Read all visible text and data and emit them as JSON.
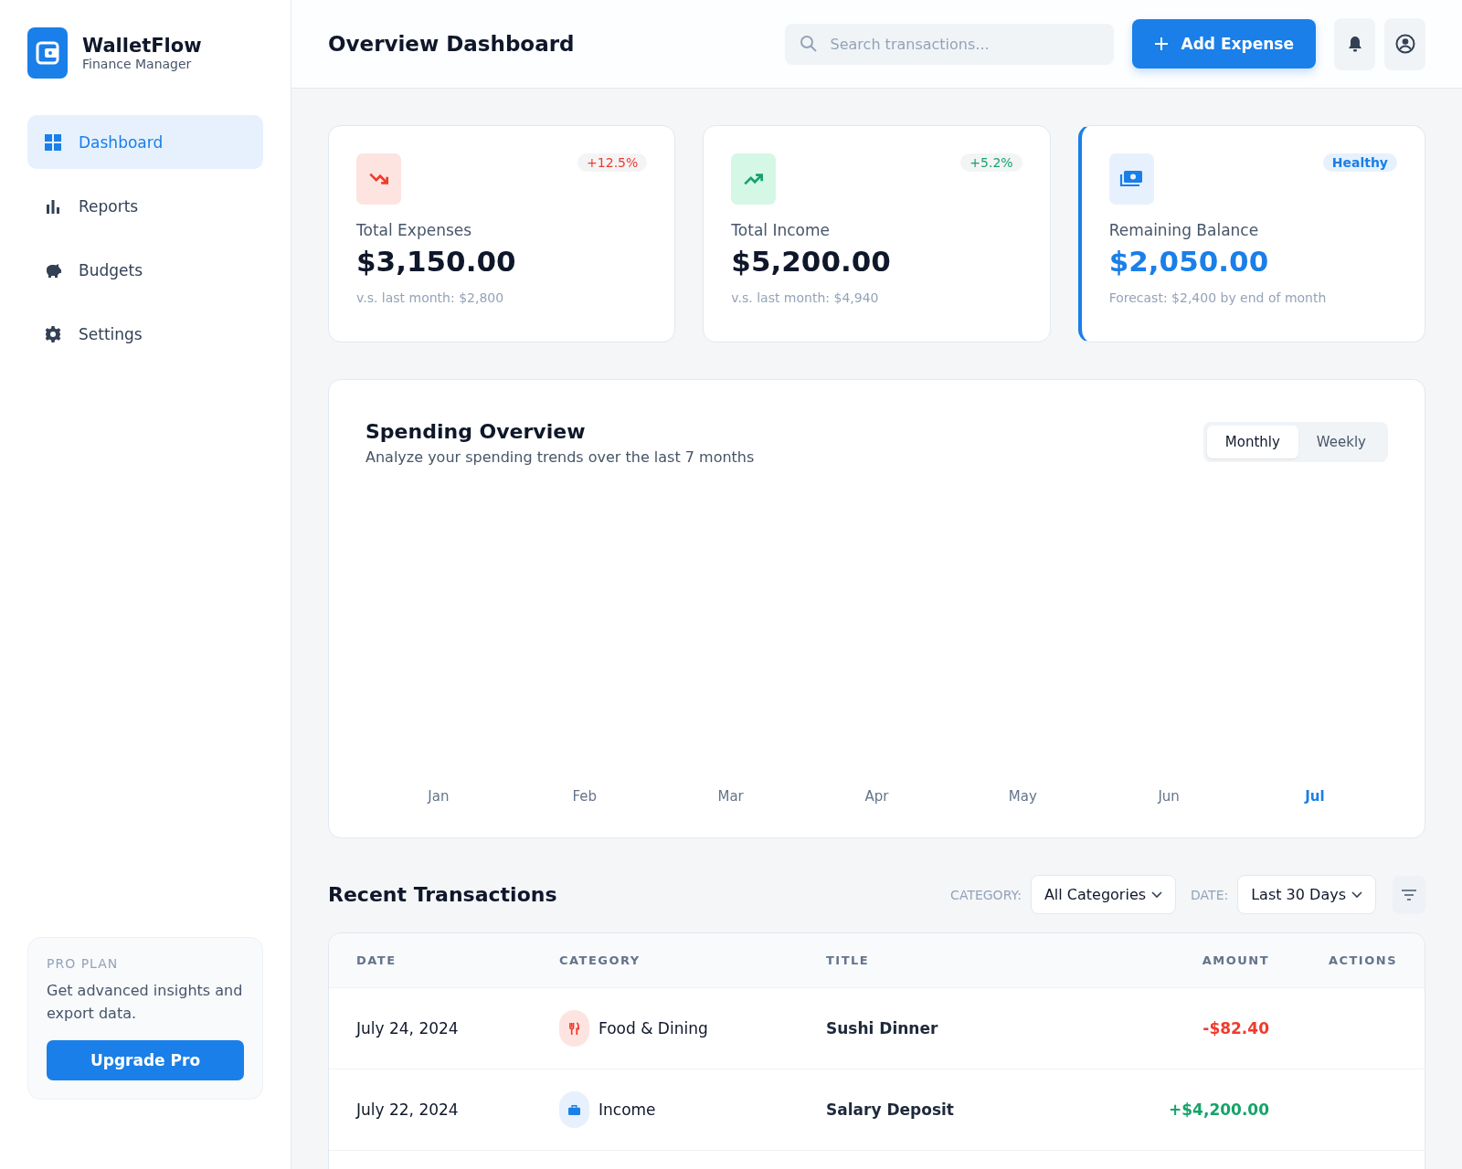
{
  "brand": {
    "name": "WalletFlow",
    "subtitle": "Finance Manager"
  },
  "nav": [
    {
      "label": "Dashboard",
      "kind": "grid",
      "selected": true
    },
    {
      "label": "Reports",
      "kind": "bars",
      "selected": false
    },
    {
      "label": "Budgets",
      "kind": "piggy",
      "selected": false
    },
    {
      "label": "Settings",
      "kind": "gear",
      "selected": false
    }
  ],
  "promo": {
    "label": "PRO PLAN",
    "text": "Get advanced insights and export data.",
    "button": "Upgrade Pro"
  },
  "header": {
    "title": "Overview Dashboard",
    "search": {
      "placeholder": "Search transactions..."
    },
    "add_button": "Add Expense"
  },
  "stats": [
    {
      "kind": "expense",
      "label": "Total Expenses",
      "value": "$3,150.00",
      "badge": "+12.5%",
      "note": "v.s. last month: $2,800",
      "highlighted": false
    },
    {
      "kind": "income",
      "label": "Total Income",
      "value": "$5,200.00",
      "badge": "+5.2%",
      "note": "v.s. last month: $4,940",
      "highlighted": false
    },
    {
      "kind": "balance",
      "label": "Remaining Balance",
      "value": "$2,050.00",
      "badge": "Healthy",
      "note": "Forecast: $2,400 by end of month",
      "highlighted": true
    }
  ],
  "spending": {
    "title": "Spending Overview",
    "subtitle": "Analyze your spending trends over the last 7 months",
    "toggle": [
      {
        "label": "Monthly",
        "selected": true
      },
      {
        "label": "Weekly",
        "selected": false
      }
    ],
    "months": [
      {
        "label": "Jan",
        "selected": false
      },
      {
        "label": "Feb",
        "selected": false
      },
      {
        "label": "Mar",
        "selected": false
      },
      {
        "label": "Apr",
        "selected": false
      },
      {
        "label": "May",
        "selected": false
      },
      {
        "label": "Jun",
        "selected": false
      },
      {
        "label": "Jul",
        "selected": true
      }
    ]
  },
  "transactions": {
    "title": "Recent Transactions",
    "filters": [
      {
        "label": "CATEGORY:",
        "value": "All Categories"
      },
      {
        "label": "DATE:",
        "value": "Last 30 Days"
      }
    ],
    "columns": [
      "DATE",
      "CATEGORY",
      "TITLE",
      "AMOUNT",
      "ACTIONS"
    ],
    "rows": [
      {
        "date": "July 24, 2024",
        "category": "Food & Dining",
        "title": "Sushi Dinner",
        "amount": "-$82.40",
        "kind": "expense"
      },
      {
        "date": "July 22, 2024",
        "category": "Income",
        "title": "Salary Deposit",
        "amount": "+$4,200.00",
        "kind": "income"
      }
    ]
  }
}
